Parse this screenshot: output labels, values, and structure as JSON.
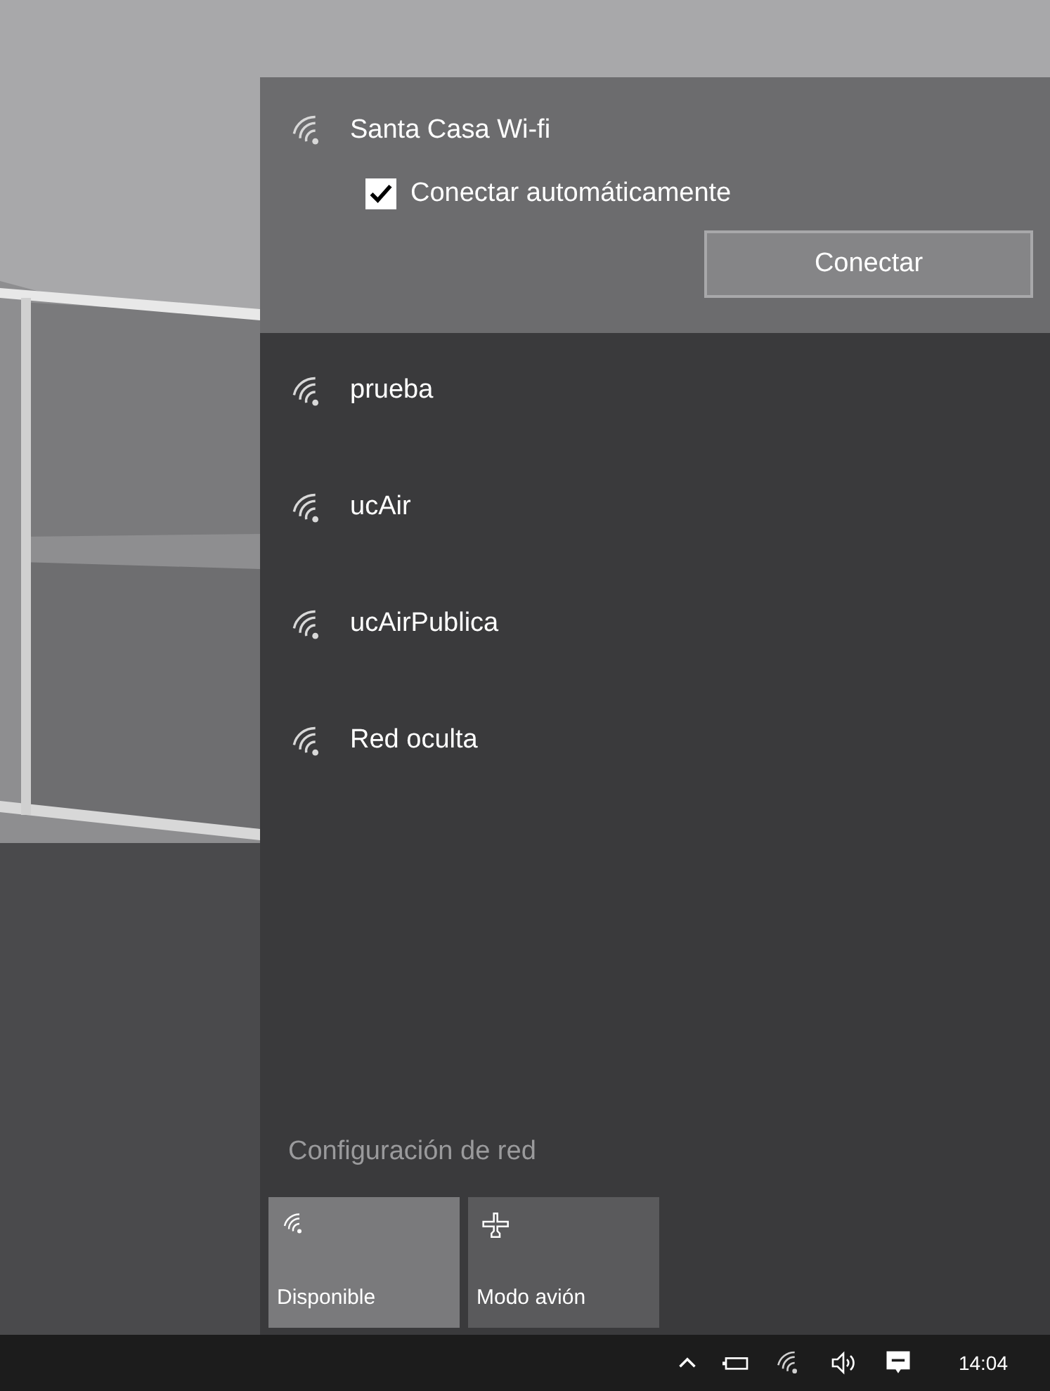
{
  "networks": [
    {
      "name": "Santa Casa Wi-fi",
      "expanded": true,
      "auto_connect": {
        "label": "Conectar automáticamente",
        "checked": true
      },
      "button": "Conectar"
    },
    {
      "name": "prueba",
      "expanded": false
    },
    {
      "name": "ucAir",
      "expanded": false
    },
    {
      "name": "ucAirPublica",
      "expanded": false
    },
    {
      "name": "Red oculta",
      "expanded": false
    }
  ],
  "settings_link": "Configuración de red",
  "quick_actions": [
    {
      "kind": "wifi",
      "label": "Disponible",
      "on": true
    },
    {
      "kind": "airplane",
      "label": "Modo avión",
      "on": false
    }
  ],
  "taskbar": {
    "time": "14:04"
  }
}
